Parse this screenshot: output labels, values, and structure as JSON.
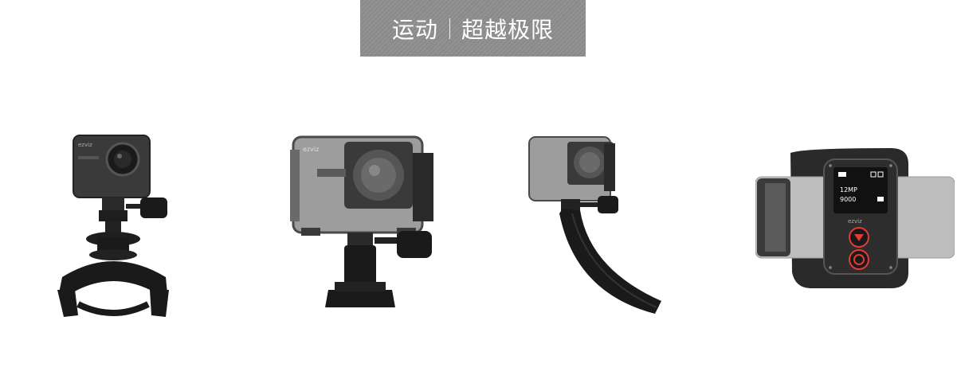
{
  "banner": {
    "title_left": "运动",
    "title_right": "超越极限"
  },
  "products": [
    {
      "icon": "camera-handlebar-mount-icon"
    },
    {
      "icon": "camera-waterproof-housing-icon"
    },
    {
      "icon": "camera-curved-mount-icon"
    },
    {
      "icon": "wrist-remote-control-icon",
      "screen_lines": [
        "12MP",
        "9000"
      ],
      "brand": "ezviz"
    }
  ],
  "camera_brand": "ezviz"
}
